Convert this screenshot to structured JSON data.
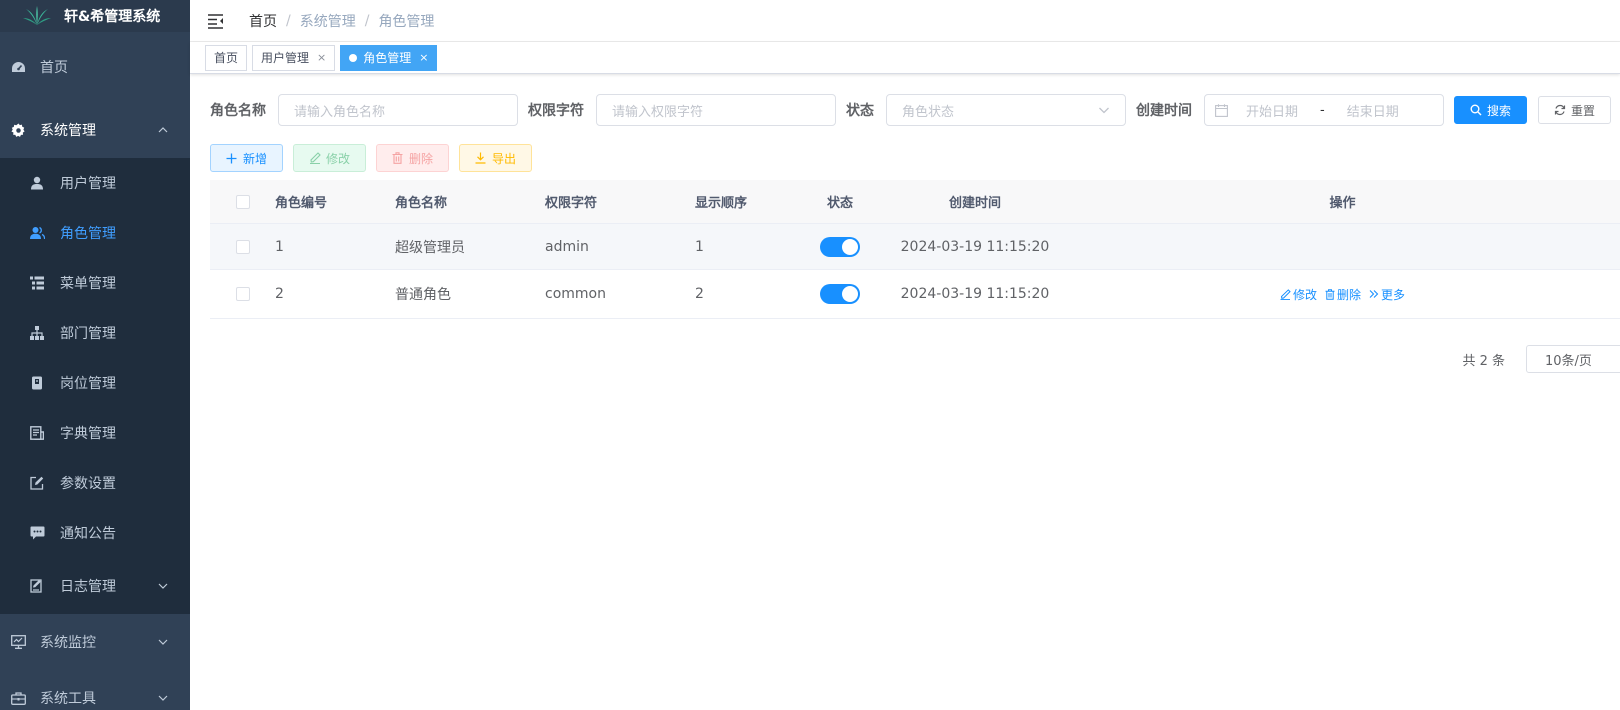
{
  "app": {
    "title": "轩&希管理系统"
  },
  "sidebar": {
    "home": "首页",
    "system": "系统管理",
    "sub": [
      "用户管理",
      "角色管理",
      "菜单管理",
      "部门管理",
      "岗位管理",
      "字典管理",
      "参数设置",
      "通知公告",
      "日志管理"
    ],
    "monitor": "系统监控",
    "tools": "系统工具"
  },
  "breadcrumb": [
    "首页",
    "系统管理",
    "角色管理"
  ],
  "tags": [
    {
      "label": "首页"
    },
    {
      "label": "用户管理",
      "close": "×"
    },
    {
      "label": "角色管理",
      "close": "×"
    }
  ],
  "search": {
    "role_name_label": "角色名称",
    "role_name_placeholder": "请输入角色名称",
    "role_key_label": "权限字符",
    "role_key_placeholder": "请输入权限字符",
    "status_label": "状态",
    "status_placeholder": "角色状态",
    "date_label": "创建时间",
    "start_placeholder": "开始日期",
    "range_sep": "-",
    "end_placeholder": "结束日期",
    "search_btn": "搜索",
    "reset_btn": "重置"
  },
  "toolbar": {
    "add": "新增",
    "edit": "修改",
    "delete": "删除",
    "export": "导出"
  },
  "table": {
    "headers": [
      "角色编号",
      "角色名称",
      "权限字符",
      "显示顺序",
      "状态",
      "创建时间",
      "操作"
    ],
    "rows": [
      {
        "id": "1",
        "name": "超级管理员",
        "key": "admin",
        "sort": "1",
        "status_on": true,
        "time": "2024-03-19 11:15:20"
      },
      {
        "id": "2",
        "name": "普通角色",
        "key": "common",
        "sort": "2",
        "status_on": true,
        "time": "2024-03-19 11:15:20"
      }
    ],
    "ops": {
      "edit": "修改",
      "delete": "删除",
      "more": "更多"
    }
  },
  "pagination": {
    "total": "共 2 条",
    "page_size": "10条/页"
  },
  "colors": {
    "sidebar_bg": "#304156",
    "submenu_bg": "#1f2d3d",
    "accent": "#1890ff",
    "active_tag": "#42a5f5"
  }
}
